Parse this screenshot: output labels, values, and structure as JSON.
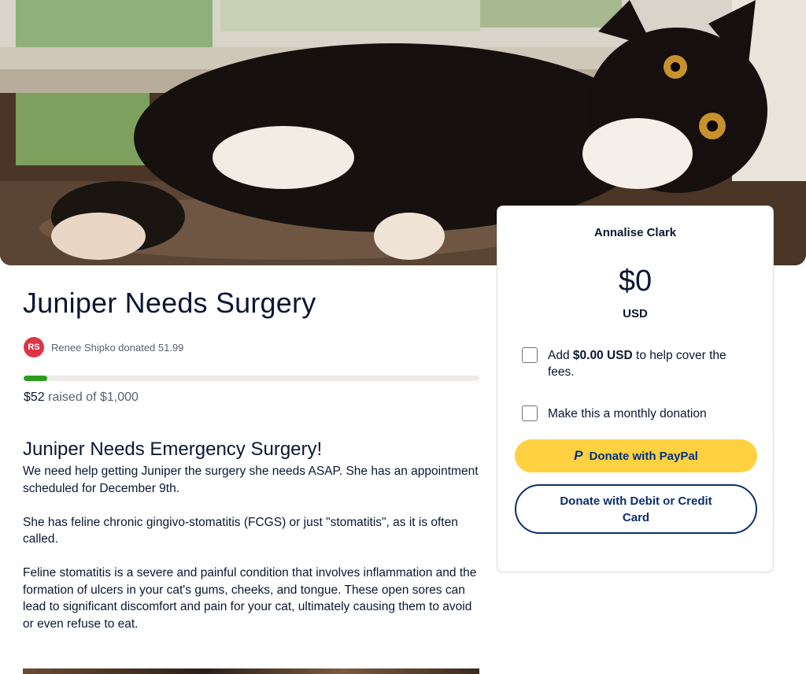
{
  "campaign": {
    "title": "Juniper Needs Surgery",
    "recent_donor": {
      "initials": "RS",
      "text": "Renee Shipko donated 51.99",
      "avatar_color": "#dc3545"
    },
    "progress": {
      "fraction": 0.052,
      "raised": "$52",
      "raised_suffix": " raised of $1,000"
    },
    "story_heading": "Juniper Needs Emergency Surgery!",
    "story_paragraphs": [
      "We need help getting Juniper the surgery she needs ASAP. She has an appointment scheduled for December 9th.",
      "She has feline chronic gingivo-stomatitis (FCGS) or just \"stomatitis\", as it is often called.",
      "Feline stomatitis is a severe and painful condition that involves inflammation and the formation of ulcers in your cat's gums, cheeks, and tongue. These open sores can lead to significant discomfort and pain for your cat, ultimately causing them to avoid or even refuse to eat."
    ]
  },
  "donation_card": {
    "recipient": "Annalise Clark",
    "amount": "$0",
    "currency": "USD",
    "fee_option": {
      "prefix": "Add ",
      "amount": "$0.00 USD",
      "suffix": " to help cover the fees."
    },
    "monthly_option": "Make this a monthly donation",
    "paypal_button": "Donate with PayPal",
    "paypal_icon": "P",
    "card_button": "Donate with Debit or Credit Card"
  },
  "colors": {
    "accent": "#2a9d1f",
    "paypal": "#ffd140",
    "navy": "#0b2f6e"
  }
}
